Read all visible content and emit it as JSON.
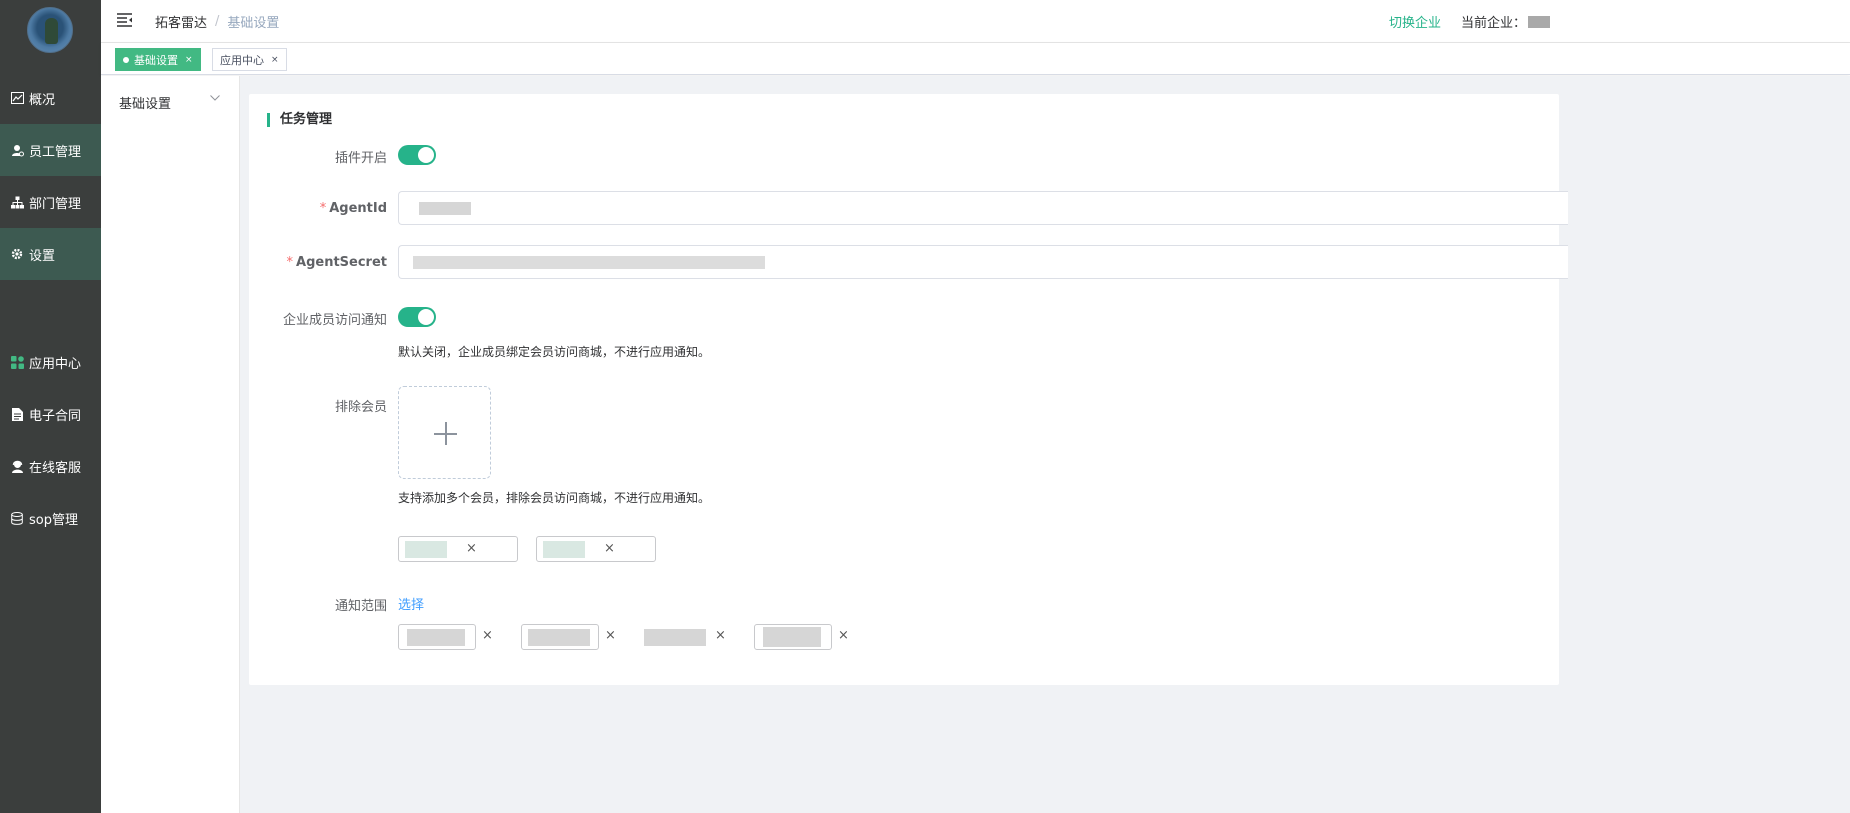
{
  "nav": {
    "items": [
      {
        "label": "概况",
        "icon": "chart-icon"
      },
      {
        "label": "员工管理",
        "icon": "user-icon"
      },
      {
        "label": "部门管理",
        "icon": "org-tree-icon"
      },
      {
        "label": "设置",
        "icon": "gear-icon"
      },
      {
        "label": "应用中心",
        "icon": "apps-grid-icon"
      },
      {
        "label": "电子合同",
        "icon": "document-icon"
      },
      {
        "label": "在线客服",
        "icon": "headset-user-icon"
      },
      {
        "label": "sop管理",
        "icon": "database-icon"
      }
    ]
  },
  "header": {
    "breadcrumb": [
      "拓客雷达",
      "基础设置"
    ],
    "breadcrumb_sep": "/",
    "switch_enterprise": "切换企业",
    "current_enterprise_label": "当前企业："
  },
  "tabs": [
    {
      "label": "基础设置",
      "close": "×",
      "active": true
    },
    {
      "label": "应用中心",
      "close": "×",
      "active": false
    }
  ],
  "submenu": {
    "item": "基础设置"
  },
  "form": {
    "section_title": "任务管理",
    "plugin_enable_label": "插件开启",
    "plugin_enabled": true,
    "agent_id_label": "AgentId",
    "agent_secret_label": "AgentSecret",
    "required_mark": "*",
    "member_notify_label": "企业成员访问通知",
    "member_notify_enabled": true,
    "member_notify_hint": "默认关闭，企业成员绑定会员访问商城，不进行应用通知。",
    "exclude_members_label": "排除会员",
    "exclude_members_hint": "支持添加多个会员，排除会员访问商城，不进行应用通知。",
    "notify_scope_label": "通知范围",
    "notify_scope_select": "选择",
    "remove_symbol": "×"
  },
  "colors": {
    "accent": "#26b38a",
    "nav_bg": "#3b3e3d",
    "nav_active": "#3d5a51",
    "tab_active": "#42b983",
    "link": "#409eff",
    "required": "#f56c6c"
  }
}
